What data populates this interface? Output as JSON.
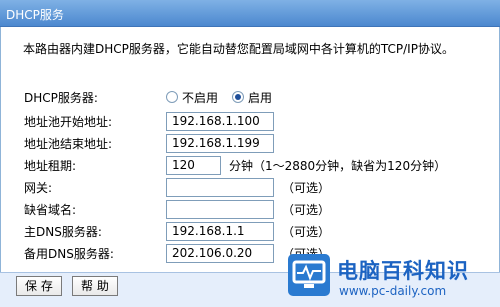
{
  "window": {
    "title": "DHCP服务"
  },
  "description": "本路由器内建DHCP服务器，它能自动替您配置局域网中各计算机的TCP/IP协议。",
  "dhcp_server": {
    "label": "DHCP服务器:",
    "options": [
      {
        "label": "不启用",
        "selected": false
      },
      {
        "label": "启用",
        "selected": true
      }
    ]
  },
  "fields": {
    "pool_start": {
      "label": "地址池开始地址:",
      "value": "192.168.1.100"
    },
    "pool_end": {
      "label": "地址池结束地址:",
      "value": "192.168.1.199"
    },
    "lease": {
      "label": "地址租期:",
      "value": "120",
      "suffix": "分钟（1～2880分钟，缺省为120分钟）"
    },
    "gateway": {
      "label": "网关:",
      "value": "",
      "suffix": "（可选）"
    },
    "domain": {
      "label": "缺省域名:",
      "value": "",
      "suffix": "（可选）"
    },
    "dns_primary": {
      "label": "主DNS服务器:",
      "value": "192.168.1.1",
      "suffix": "（可选）"
    },
    "dns_backup": {
      "label": "备用DNS服务器:",
      "value": "202.106.0.20",
      "suffix": "（可选）"
    }
  },
  "buttons": {
    "save": "保 存",
    "help": "帮 助"
  },
  "watermark": {
    "title": "电脑百科知识",
    "url": "www.pc-daily.com"
  },
  "colors": {
    "titlebar": "#4c88cf",
    "footer": "#e5eefb",
    "watermark": "#1c63c2"
  },
  "icons": {
    "logo": "pc-daily-logo-icon"
  }
}
